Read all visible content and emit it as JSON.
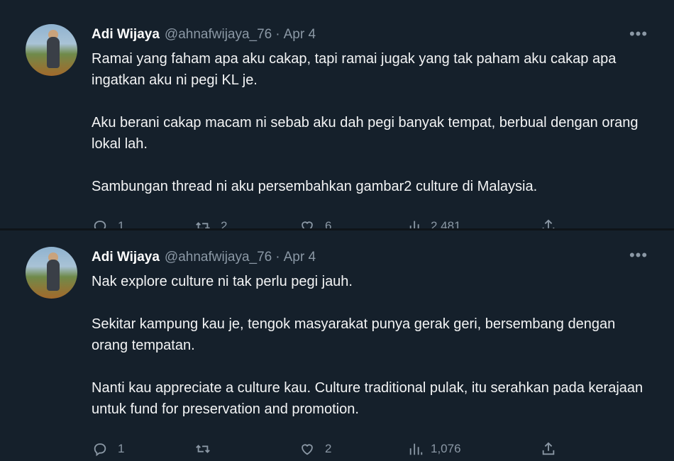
{
  "colors": {
    "background": "#15202b",
    "muted": "#8b98a5",
    "text": "#f3f4f5",
    "divider": "#38444d"
  },
  "tweets": [
    {
      "name": "Adi Wijaya",
      "handle": "@ahnafwijaya_76",
      "separator": "·",
      "date": "Apr 4",
      "more": "•••",
      "paragraphs": [
        "Ramai yang faham apa aku cakap, tapi ramai jugak yang tak paham aku cakap apa ingatkan aku ni pegi KL je.",
        "Aku berani cakap macam ni sebab aku dah pegi banyak tempat, berbual dengan orang lokal lah.",
        "Sambungan thread ni aku persembahkan gambar2 culture di Malaysia."
      ],
      "replies": "1",
      "retweets": "2",
      "likes": "6",
      "views": "2,481"
    },
    {
      "name": "Adi Wijaya",
      "handle": "@ahnafwijaya_76",
      "separator": "·",
      "date": "Apr 4",
      "more": "•••",
      "paragraphs": [
        "Nak explore culture ni tak perlu pegi jauh.",
        "Sekitar kampung kau je, tengok masyarakat punya gerak geri, bersembang dengan orang tempatan.",
        "Nanti kau appreciate a culture kau. Culture traditional pulak, itu serahkan pada kerajaan untuk fund for preservation and promotion."
      ],
      "replies": "1",
      "retweets": "",
      "likes": "2",
      "views": "1,076"
    }
  ]
}
